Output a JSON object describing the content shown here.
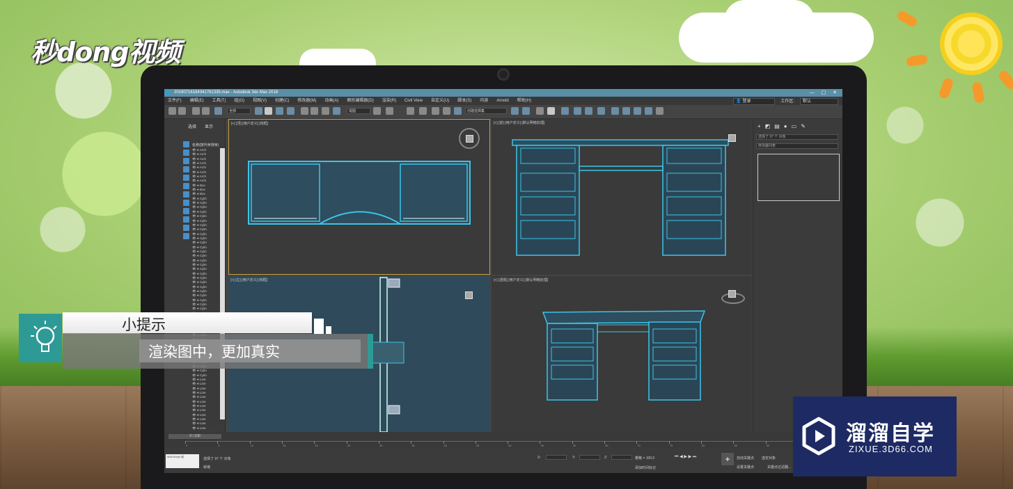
{
  "brand": {
    "top_left_logo": "秒dong视频",
    "watermark_name": "溜溜自学",
    "watermark_url": "ZIXUE.3D66.COM"
  },
  "app": {
    "window_title": "20190716184341781335.max - Autodesk 3ds Max 2018",
    "menu": [
      "文件(F)",
      "编辑(E)",
      "工具(T)",
      "组(G)",
      "视图(V)",
      "创建(C)",
      "修改器(M)",
      "动画(A)",
      "图形编辑器(D)",
      "渲染(R)",
      "Civil View",
      "自定义(U)",
      "脚本(S)",
      "内容",
      "Arnold",
      "帮助(H)"
    ],
    "sign_in": "登录",
    "workspace_label": "工作区:",
    "workspace_value": "默认",
    "toolbar": {
      "filter_dropdown": "全部",
      "view_dropdown": "视图",
      "selection_set": "创建选择集"
    }
  },
  "explorer": {
    "tabs": [
      "选择",
      "显示"
    ],
    "header": "名称(按升序排序)",
    "objects": [
      "Arch",
      "Arch",
      "Arch",
      "Arch",
      "Arch",
      "Arch",
      "Arch",
      "Arch",
      "Box",
      "Box",
      "Box",
      "Cylin",
      "Cylin",
      "Cylin",
      "Cylin",
      "Cylin",
      "Cylin",
      "Cylin",
      "Cylin",
      "Cylin",
      "Cylin",
      "Cylin",
      "Cylin",
      "Cylin",
      "Cylin",
      "Cylin",
      "Cylin",
      "Cylin",
      "Cylin",
      "Cylin",
      "Cylin",
      "Cylin",
      "Cylin",
      "Cylin",
      "Cylin",
      "Cylin",
      "Cylin",
      "Cylin",
      "Cylin",
      "Cylin",
      "Cylin",
      "Cylin",
      "Cylin",
      "Cylin",
      "Cylin",
      "Cylin",
      "Cylin",
      "Cylin",
      "Cylin",
      "Cylin",
      "Cylin",
      "Cylin",
      "Line",
      "Line",
      "Line",
      "Line",
      "Line",
      "Line",
      "Line",
      "Line",
      "Line",
      "Line",
      "Line",
      "Line"
    ]
  },
  "viewports": {
    "top": "[+] [顶] [用户定义] [线框]",
    "front": "[+] [前] [用户定义] [默认明暗处理]",
    "left": "[+] [左] [用户定义] [线框]",
    "persp": "[+] [透视] [用户定义] [默认明暗处理]"
  },
  "command_panel": {
    "object_name": "选择了 97 个 对象",
    "modifier_list": "修改器列表"
  },
  "timeline": {
    "frame_readout": "0 / 100",
    "ticks": [
      "0",
      "5",
      "10",
      "15",
      "20",
      "25",
      "30",
      "35",
      "40",
      "45",
      "50",
      "55",
      "60",
      "65",
      "70",
      "75",
      "80",
      "85",
      "90"
    ]
  },
  "status": {
    "maxscript": "MAXScript 迷",
    "selected": "选择了 97 个 对象",
    "hint": "就绪",
    "x_label": "X:",
    "y_label": "Y:",
    "z_label": "Z:",
    "grid": "栅格 = 100.0",
    "add_time_tag": "添加时间标记",
    "auto_key": "自动关键点",
    "set_key": "设置关键点",
    "selected_obj": "选定对象",
    "key_filters": "关键点过滤器..."
  },
  "hint_overlay": {
    "title": "小提示",
    "body": "渲染图中，更加真实"
  },
  "colors": {
    "hint_accent": "#2e9a95",
    "watermark_bg": "#1e2a63",
    "wireframe": "#3cc4e8",
    "titlebar": "#5a8fa8"
  }
}
